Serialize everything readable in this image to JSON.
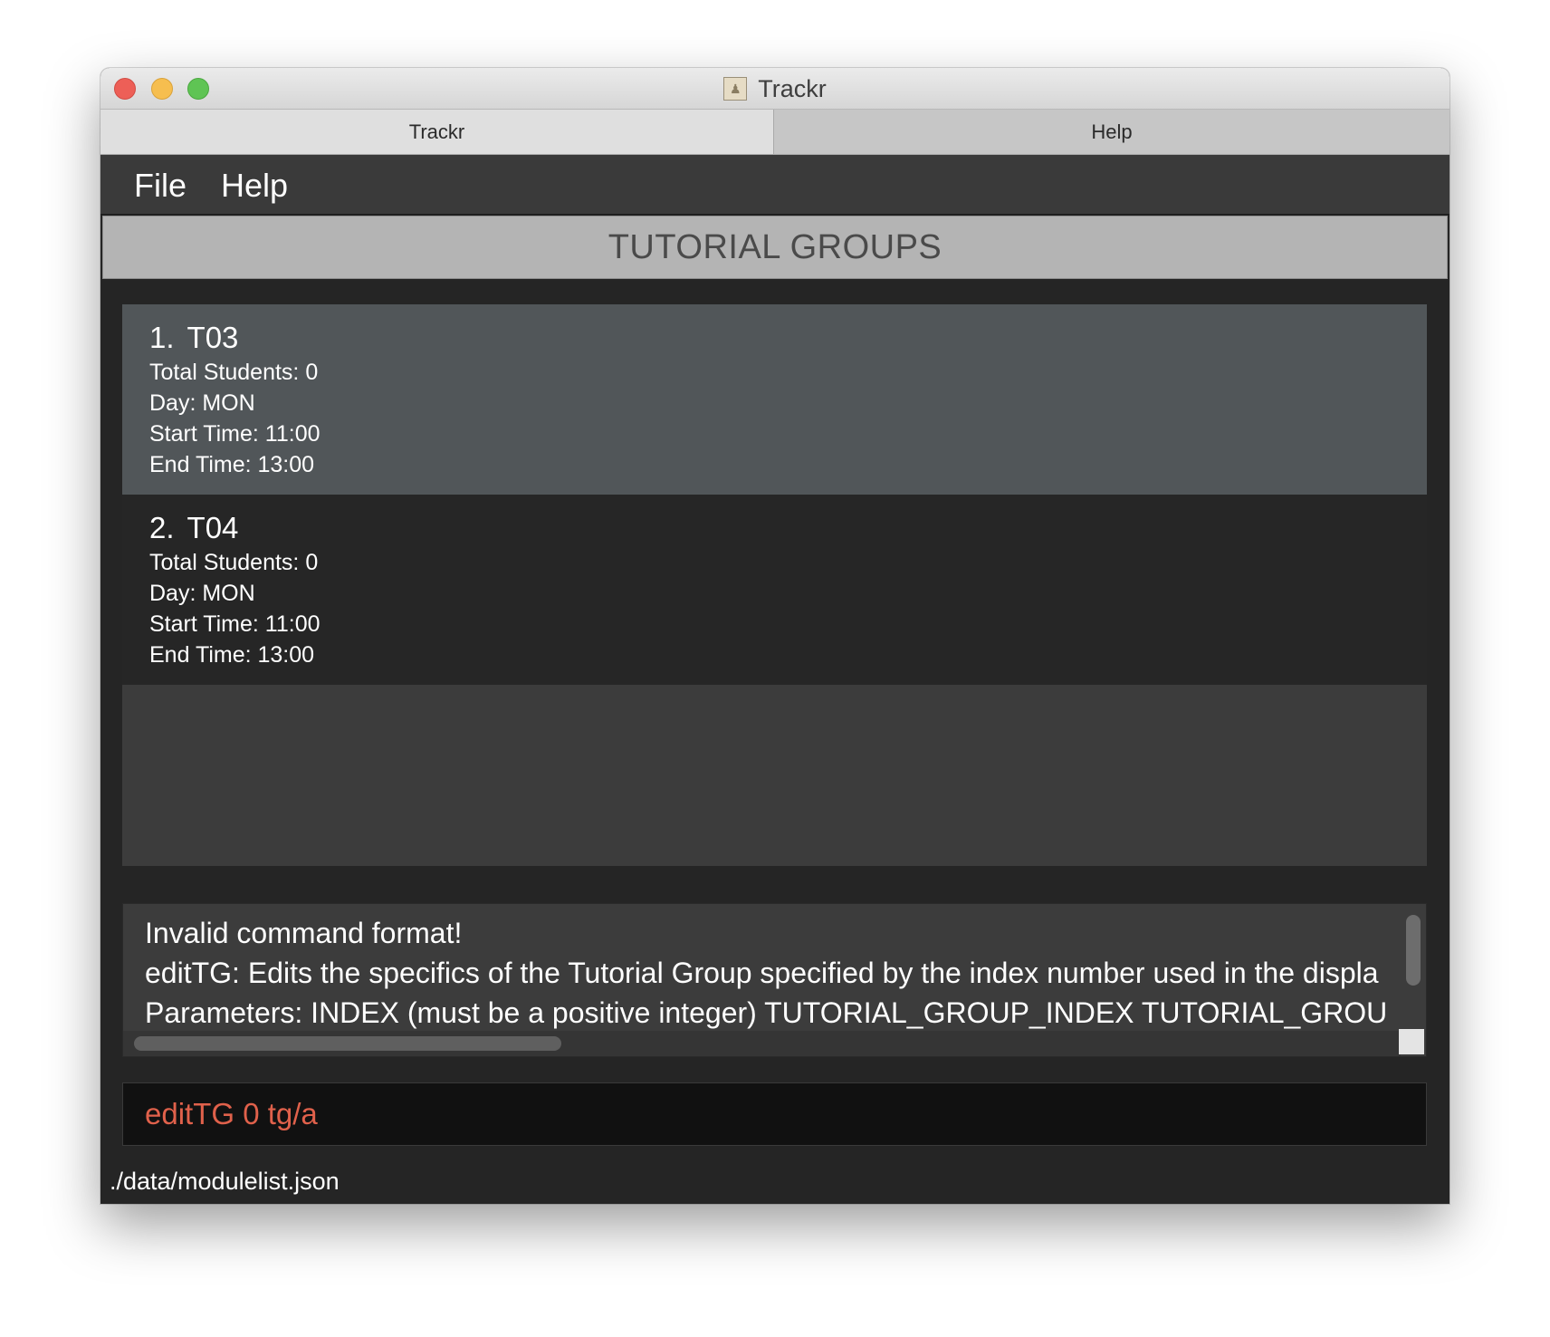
{
  "window": {
    "title": "Trackr"
  },
  "tabs": [
    {
      "label": "Trackr",
      "active": true
    },
    {
      "label": "Help",
      "active": false
    }
  ],
  "menu": {
    "file_label": "File",
    "help_label": "Help"
  },
  "section": {
    "title": "TUTORIAL GROUPS"
  },
  "tutorial_groups": [
    {
      "index": "1.",
      "name": "T03",
      "total_students": "Total Students: 0",
      "day": "Day: MON",
      "start_time": "Start Time: 11:00",
      "end_time": "End Time: 13:00",
      "selected": true
    },
    {
      "index": "2.",
      "name": "T04",
      "total_students": "Total Students: 0",
      "day": "Day: MON",
      "start_time": "Start Time: 11:00",
      "end_time": "End Time: 13:00",
      "selected": false
    }
  ],
  "result_display": {
    "lines": [
      "Invalid command format!",
      "editTG: Edits the specifics of the Tutorial Group specified by the index number used in the displa",
      "Parameters: INDEX (must be a positive integer) TUTORIAL_GROUP_INDEX TUTORIAL_GROUP_"
    ]
  },
  "command_box": {
    "value": "editTG 0 tg/a"
  },
  "status_bar": {
    "file_path": "./data/modulelist.json"
  },
  "colors": {
    "window_bg": "#252525",
    "selected_card": "#515659",
    "unselected_card": "#262626",
    "command_text": "#e0614b",
    "header_bg": "#b4b4b4"
  }
}
